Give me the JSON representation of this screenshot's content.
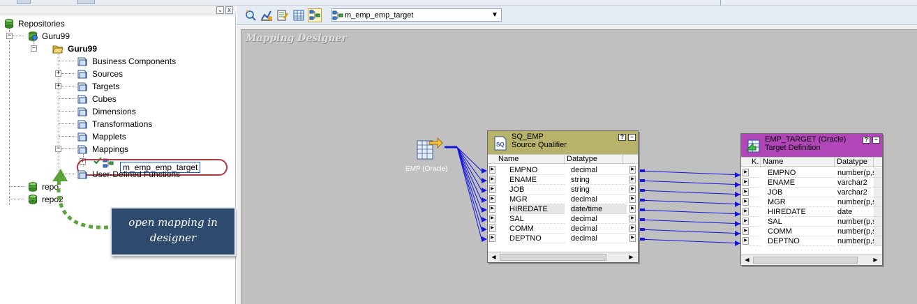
{
  "navigator": {
    "root_label": "Repositories",
    "repo_label": "Guru99",
    "folder_label": "Guru99",
    "nodes": [
      {
        "label": "Business Components"
      },
      {
        "label": "Sources"
      },
      {
        "label": "Targets"
      },
      {
        "label": "Cubes"
      },
      {
        "label": "Dimensions"
      },
      {
        "label": "Transformations"
      },
      {
        "label": "Mapplets"
      },
      {
        "label": "Mappings"
      },
      {
        "label": "m_emp_emp_target"
      },
      {
        "label": "User-Defined Functions"
      }
    ],
    "other_repos": [
      {
        "label": "repo"
      },
      {
        "label": "repo2"
      }
    ],
    "window_buttons": [
      "⌄",
      "x"
    ]
  },
  "callout": {
    "text": "open mapping in designer"
  },
  "toolbar": {
    "selected_mapping": "m_emp_emp_target"
  },
  "canvas": {
    "title": "Mapping Designer",
    "source": {
      "label": "EMP (Oracle)"
    },
    "source_qualifier": {
      "title": "SQ_EMP",
      "subtitle": "Source Qualifier",
      "col_name": "Name",
      "col_type": "Datatype",
      "ports": [
        {
          "name": "EMPNO",
          "type": "decimal"
        },
        {
          "name": "ENAME",
          "type": "string"
        },
        {
          "name": "JOB",
          "type": "string"
        },
        {
          "name": "MGR",
          "type": "decimal"
        },
        {
          "name": "HIREDATE",
          "type": "date/time"
        },
        {
          "name": "SAL",
          "type": "decimal"
        },
        {
          "name": "COMM",
          "type": "decimal"
        },
        {
          "name": "DEPTNO",
          "type": "decimal"
        }
      ]
    },
    "target": {
      "title": "EMP_TARGET (Oracle)",
      "subtitle": "Target Definition",
      "col_key": "K.",
      "col_name": "Name",
      "col_type": "Datatype",
      "ports": [
        {
          "name": "EMPNO",
          "type": "number(p,s"
        },
        {
          "name": "ENAME",
          "type": "varchar2"
        },
        {
          "name": "JOB",
          "type": "varchar2"
        },
        {
          "name": "MGR",
          "type": "number(p,s"
        },
        {
          "name": "HIREDATE",
          "type": "date"
        },
        {
          "name": "SAL",
          "type": "number(p,s"
        },
        {
          "name": "COMM",
          "type": "number(p,s"
        },
        {
          "name": "DEPTNO",
          "type": "number(p,s"
        }
      ]
    },
    "box_buttons": {
      "help": "?",
      "minimize": "–"
    }
  },
  "colors": {
    "sq_header": "#b8b36a",
    "target_header": "#b146b8",
    "link": "#1515e0",
    "callout_bg": "#2e4b6e",
    "callout_arrow": "#5aa43a",
    "ellipse": "#b0383f"
  }
}
